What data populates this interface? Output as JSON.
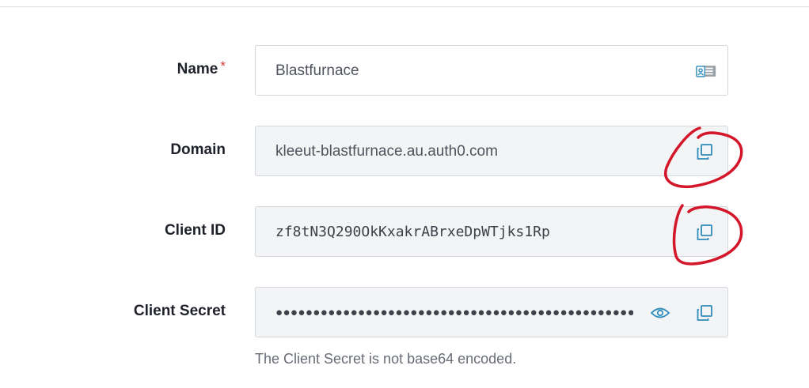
{
  "form": {
    "name": {
      "label": "Name",
      "required_mark": "*",
      "value": "Blastfurnace",
      "icon": "contact-card-icon"
    },
    "domain": {
      "label": "Domain",
      "value": "kleeut-blastfurnace.au.auth0.com",
      "icon": "copy-icon"
    },
    "client_id": {
      "label": "Client ID",
      "value": "zf8tN3Q290OkKxakrABrxeDpWTjks1Rp",
      "icon": "copy-icon"
    },
    "client_secret": {
      "label": "Client Secret",
      "masked_value": "●●●●●●●●●●●●●●●●●●●●●●●●●●●●●●●●●●●●●●●●●●●●●●●●●●●●●●●●●●●●●●●●",
      "icons": [
        "eye-icon",
        "copy-icon"
      ],
      "hint": "The Client Secret is not base64 encoded."
    }
  },
  "colors": {
    "accent": "#2f8cbb",
    "annotation": "#d4162a",
    "required": "#d03c38",
    "readonly_bg": "#f3f4f5"
  }
}
